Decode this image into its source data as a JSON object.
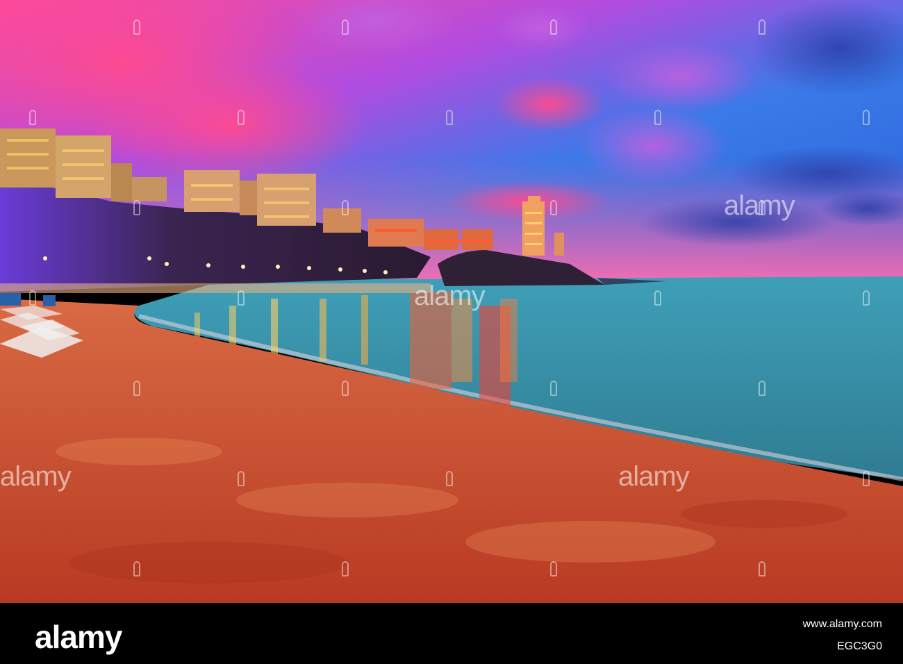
{
  "image": {
    "colors": {
      "sky_top": "#2a5fd8",
      "sky_pink": "#ff3aa0",
      "sky_horizon": "#ff5fa8",
      "cliff": "#2a1b3a",
      "cliff_light": "#6b3fd0",
      "sea": "#3fa6b4",
      "sea_dark": "#2a6f8a",
      "sand": "#c94a2e",
      "sand_light": "#e07a4a",
      "city_lights": "#ffb347",
      "reflection": "#ff6a2a"
    }
  },
  "watermark": {
    "text": "alamy"
  },
  "footer": {
    "logo": "alamy",
    "domain": "www.alamy.com",
    "image_code": "EGC3G0"
  }
}
